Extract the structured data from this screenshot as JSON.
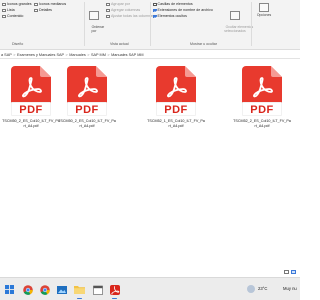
{
  "ribbon": {
    "layout_items": [
      "Iconos grandes",
      "Iconos medianos",
      "Lista",
      "Detalles",
      "Contenido"
    ],
    "sort_label": "Ordenar\npor",
    "current_view": [
      "Agrupar por",
      "Agregar columnas",
      "Ajustar todas las columnas"
    ],
    "checkboxes": [
      {
        "label": "Casillas de elementos",
        "checked": false
      },
      {
        "label": "Extensiones de nombre de archivo",
        "checked": true
      },
      {
        "label": "Elementos ocultos",
        "checked": true
      }
    ],
    "hide_selected": "Ocultar elementos\nseleccionados",
    "options_label": "Opciones",
    "groups": {
      "layout": "Diseño",
      "current_view": "Vista actual",
      "show_hide": "Mostrar u ocultar"
    }
  },
  "address": {
    "crumbs": [
      "a SAP",
      "Examenes y Manuales SAP",
      "Manuales",
      "SAP MM",
      "Manuales SAP MM"
    ],
    "separator": ">"
  },
  "files": [
    {
      "name": "TSCM50_2_ES_Col10_ILT_FV_Part_A4.pdf",
      "badge": "PDF"
    },
    {
      "name": "TSCM50_2_ES_Col10_ILT_FV_Part_A4.pdf",
      "badge": "PDF"
    },
    {
      "name": "TSCM52_1_ES_Col10_ILT_FV_Part_A4.pdf",
      "badge": "PDF"
    },
    {
      "name": "TSCM52_2_ES_Col10_ILT_FV_Part_A4.pdf",
      "badge": "PDF"
    }
  ],
  "taskbar": {
    "weather": "23°C",
    "weather_desc": "Muy nu"
  },
  "colors": {
    "pdf_red": "#e83a2e",
    "accent": "#3b78d8"
  }
}
